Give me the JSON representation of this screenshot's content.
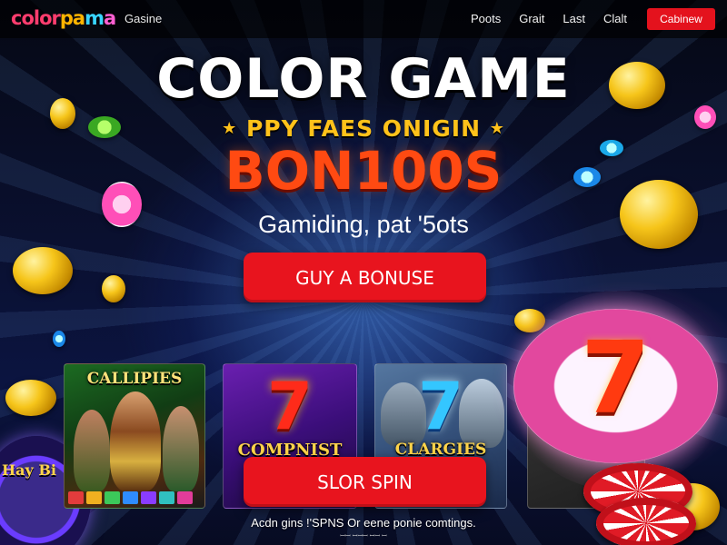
{
  "nav": {
    "logo_parts": [
      "color",
      "pa",
      "m",
      "a"
    ],
    "subtitle": "Gasine",
    "links": [
      "Poots",
      "Grait",
      "Last",
      "Clalt"
    ],
    "button_label": "Cabinew"
  },
  "hero": {
    "title": "COLOR GAME",
    "tagline": "PPY FAES ONIGIN",
    "bonus": "BON100S",
    "subtitle": "Gamiding, pat '5ots",
    "cta_label": "GUY A BONUSE"
  },
  "games": [
    {
      "title": "CALLIPIES",
      "name": "Callipies"
    },
    {
      "title": "COMPNIST",
      "name": "Compnist",
      "symbol": "7"
    },
    {
      "title": "CLARGIES",
      "name": "Clargies",
      "symbol": "7"
    },
    {
      "title": "",
      "name": ""
    }
  ],
  "spin": {
    "label": "SLOR SPIN"
  },
  "featured": {
    "symbol": "7"
  },
  "roulette": {
    "text": "Hay Bi"
  },
  "footer": {
    "text": "Acdn gins !'SPNS Or eene ponie comtings.",
    "small": "ꟷꟷ ꟷꟷꟷ ꟷꟷ ꟷ"
  },
  "colors": {
    "accent_red": "#e8141e",
    "title_orange": "#ff4a12",
    "tagline_gold": "#ffc21a",
    "coin_gold": "#f6c51a"
  },
  "icons": [
    "star-icon",
    "coin-icon",
    "poker-chip-icon",
    "roulette-icon"
  ]
}
